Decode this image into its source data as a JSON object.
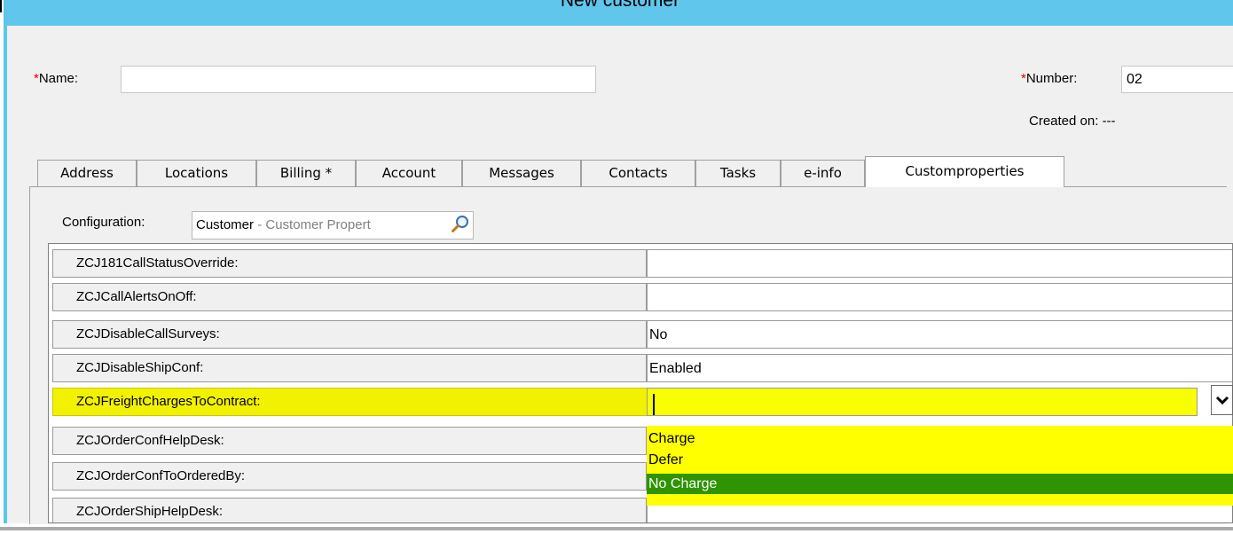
{
  "window": {
    "title": "New customer",
    "title_color": "#60c6ec"
  },
  "form": {
    "name_required_mark": "*",
    "name_label": "Name:",
    "name_value": "",
    "number_required_mark": "*",
    "number_label": "Number:",
    "number_value": "02",
    "created_label": "Created on:",
    "created_value": "---"
  },
  "tabs": [
    {
      "label": "Address"
    },
    {
      "label": "Locations"
    },
    {
      "label": "Billing *"
    },
    {
      "label": "Account"
    },
    {
      "label": "Messages"
    },
    {
      "label": "Contacts"
    },
    {
      "label": "Tasks"
    },
    {
      "label": "e-info"
    },
    {
      "label": "Customproperties",
      "active": true
    }
  ],
  "configuration": {
    "label": "Configuration:",
    "value_main": "Customer",
    "value_sub": " - Customer Propert",
    "icon": "magnifier-icon"
  },
  "properties": [
    {
      "name": "ZCJ181CallStatusOverride:",
      "value": ""
    },
    {
      "name": "ZCJCallAlertsOnOff:",
      "value": ""
    },
    {
      "name": "ZCJDisableCallSurveys:",
      "value": "No"
    },
    {
      "name": "ZCJDisableShipConf:",
      "value": "Enabled"
    },
    {
      "name": "ZCJFreightChargesToContract:",
      "value": "",
      "highlighted": true
    },
    {
      "name": "ZCJOrderConfHelpDesk:",
      "value": ""
    },
    {
      "name": "ZCJOrderConfToOrderedBy:",
      "value": ""
    },
    {
      "name": "ZCJOrderShipHelpDesk:",
      "value": ""
    }
  ],
  "dropdown": {
    "options": [
      "Charge",
      "Defer",
      "No Charge"
    ],
    "selected": "No Charge",
    "highlight_color": "#ffff00",
    "selected_color": "#2e9400"
  },
  "colors": {
    "required": "#e00000",
    "highlight": "#f2f200"
  }
}
